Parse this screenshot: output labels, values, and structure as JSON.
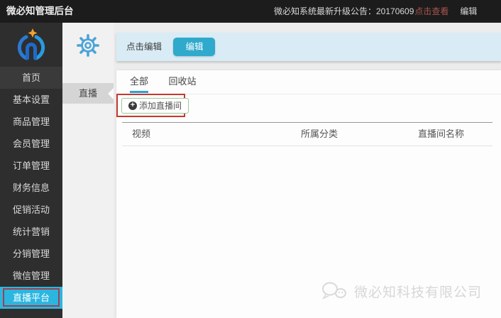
{
  "topbar": {
    "title": "微必知管理后台",
    "announcement_prefix": "微必知系统最新升级公告：20170609",
    "announcement_link": "点击查看",
    "announcement_edit": "编辑"
  },
  "sidebar": {
    "items": [
      {
        "label": "首页",
        "active": false
      },
      {
        "label": "基本设置",
        "active": false
      },
      {
        "label": "商品管理",
        "active": false
      },
      {
        "label": "会员管理",
        "active": false
      },
      {
        "label": "订单管理",
        "active": false
      },
      {
        "label": "财务信息",
        "active": false
      },
      {
        "label": "促销活动",
        "active": false
      },
      {
        "label": "统计营销",
        "active": false
      },
      {
        "label": "分销管理",
        "active": false
      },
      {
        "label": "微信管理",
        "active": false
      },
      {
        "label": "直播平台",
        "active": true
      }
    ]
  },
  "subnav": {
    "gear_icon": "gear-icon",
    "item_label": "直播"
  },
  "editbar": {
    "hint": "点击编辑",
    "button_label": "编辑"
  },
  "tabs": [
    {
      "label": "全部",
      "active": true
    },
    {
      "label": "回收站",
      "active": false
    }
  ],
  "add_button": {
    "icon": "plus-circle-icon",
    "label": "添加直播间"
  },
  "table": {
    "headers": [
      "视频",
      "所属分类",
      "直播间名称"
    ]
  },
  "watermark": {
    "company": "微必知科技有限公司"
  },
  "colors": {
    "topbar_bg": "#1c1c1c",
    "sidebar_bg": "#2e2e2e",
    "active_item_bg": "#2bb6e0",
    "annotation_red": "#c5392f",
    "sidebar_annotation_red": "#9e4050",
    "announcement_link_red": "#a9544f",
    "edit_button_teal": "#2fa9cc",
    "bluebar_bg": "#d9ecf6",
    "tab_underline_blue": "#2f9fd6",
    "add_button_border_green": "#9cc89c",
    "logo_blue": "#2a8ad6",
    "logo_star_orange": "#f0a32a"
  }
}
